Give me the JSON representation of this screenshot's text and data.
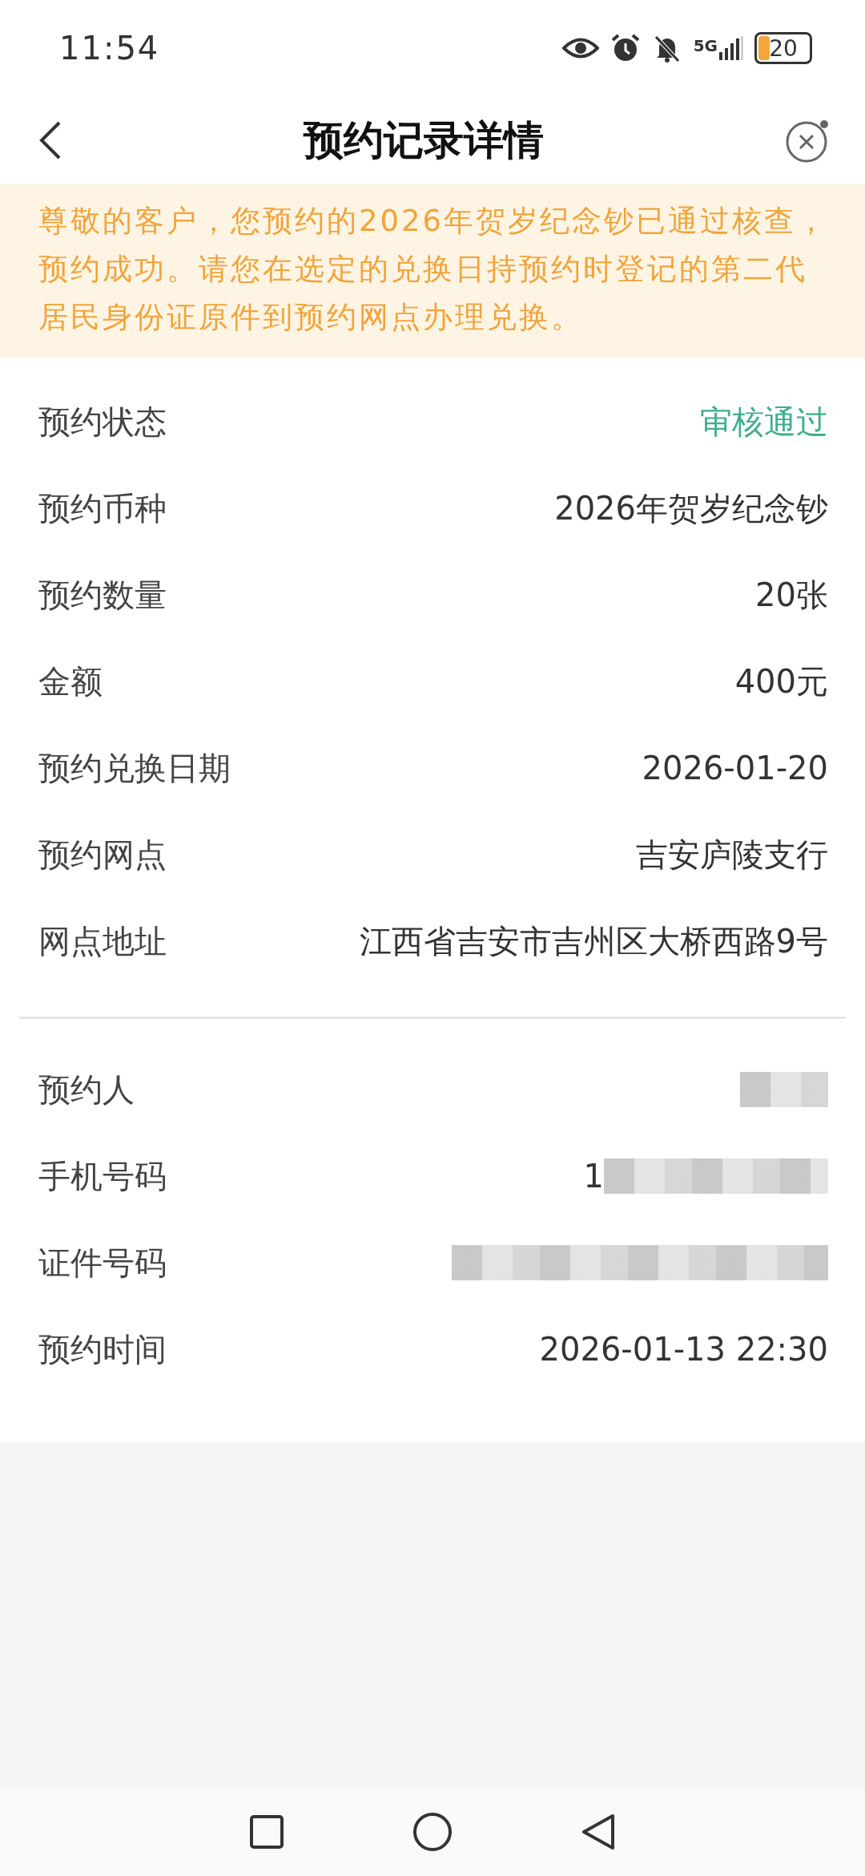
{
  "status_bar": {
    "time": "11:54",
    "network": "5G",
    "battery": "20"
  },
  "header": {
    "title": "预约记录详情"
  },
  "notice": "尊敬的客户，您预约的2026年贺岁纪念钞已通过核查，预约成功。请您在选定的兑换日持预约时登记的第二代居民身份证原件到预约网点办理兑换。",
  "details": [
    {
      "label": "预约状态",
      "value": "审核通过",
      "kind": "status"
    },
    {
      "label": "预约币种",
      "value": "2026年贺岁纪念钞",
      "kind": "text"
    },
    {
      "label": "预约数量",
      "value": "20张",
      "kind": "text"
    },
    {
      "label": "金额",
      "value": "400元",
      "kind": "text"
    },
    {
      "label": "预约兑换日期",
      "value": "2026-01-20",
      "kind": "text"
    },
    {
      "label": "预约网点",
      "value": "吉安庐陵支行",
      "kind": "text"
    },
    {
      "label": "网点地址",
      "value": "江西省吉安市吉州区大桥西路9号",
      "kind": "text"
    }
  ],
  "applicant": [
    {
      "label": "预约人",
      "kind": "redacted"
    },
    {
      "label": "手机号码",
      "value": "1",
      "kind": "redacted"
    },
    {
      "label": "证件号码",
      "kind": "redacted"
    },
    {
      "label": "预约时间",
      "value": "2026-01-13 22:30",
      "kind": "text"
    }
  ]
}
